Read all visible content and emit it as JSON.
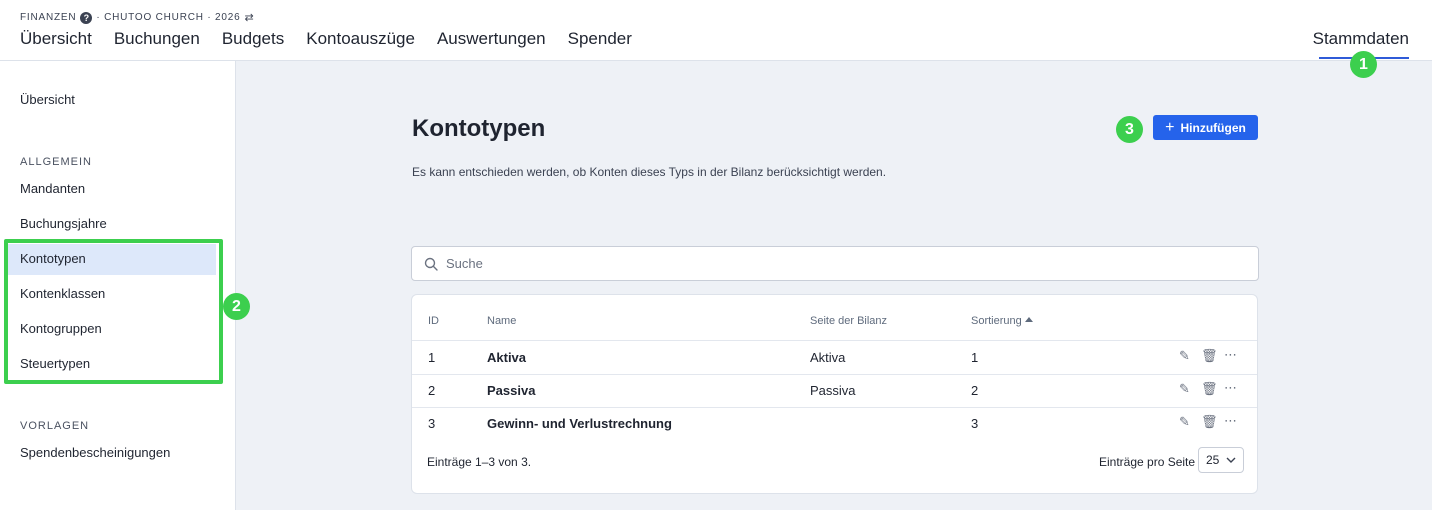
{
  "header": {
    "breadcrumb_app": "FINANZEN",
    "breadcrumb_help": "?",
    "breadcrumb_context": "· CHUTOO CHURCH · 2026",
    "nav": [
      "Übersicht",
      "Buchungen",
      "Budgets",
      "Kontoauszüge",
      "Auswertungen",
      "Spender"
    ],
    "nav_right": "Stammdaten"
  },
  "sidebar": {
    "overview": "Übersicht",
    "section_general": "ALLGEMEIN",
    "general_items": [
      "Mandanten",
      "Buchungsjahre",
      "Kontotypen",
      "Kontenklassen",
      "Kontogruppen",
      "Steuertypen"
    ],
    "section_templates": "VORLAGEN",
    "template_items": [
      "Spendenbescheinigungen"
    ]
  },
  "annotations": {
    "badge1": "1",
    "badge2": "2",
    "badge3": "3",
    "highlight_color": "#3ccf4e"
  },
  "main": {
    "title": "Kontotypen",
    "description": "Es kann entschieden werden, ob Konten dieses Typs in der Bilanz berücksichtigt werden.",
    "add_button": "Hinzufügen",
    "search_placeholder": "Suche",
    "columns": {
      "id": "ID",
      "name": "Name",
      "side": "Seite der Bilanz",
      "sort": "Sortierung"
    },
    "rows": [
      {
        "id": "1",
        "name": "Aktiva",
        "side": "Aktiva",
        "sort": "1"
      },
      {
        "id": "2",
        "name": "Passiva",
        "side": "Passiva",
        "sort": "2"
      },
      {
        "id": "3",
        "name": "Gewinn- und Verlustrechnung",
        "side": "",
        "sort": "3"
      }
    ],
    "footer_entries": "Einträge 1–3 von 3.",
    "per_page_label": "Einträge pro Seite",
    "per_page_value": "25"
  },
  "colors": {
    "accent": "#2563eb",
    "active_bg": "#dde8fa",
    "page_bg": "#eef1f6"
  },
  "icons": [
    "help-icon",
    "swap-icon",
    "plus-icon",
    "search-icon",
    "edit-icon",
    "delete-icon",
    "more-icon",
    "chevron-down-icon"
  ]
}
